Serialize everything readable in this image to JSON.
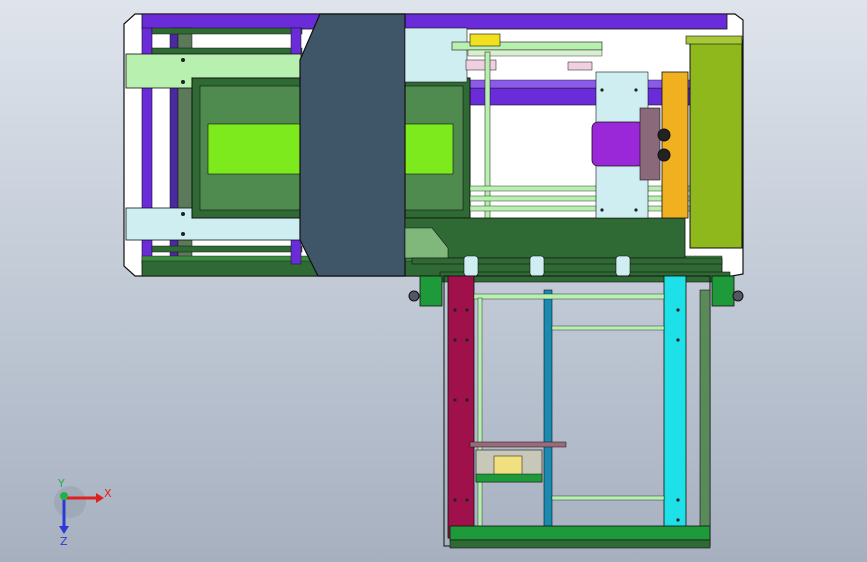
{
  "viewport": {
    "background_top": "#dfe4ec",
    "background_bottom": "#a6b0bf"
  },
  "triad": {
    "x_label": "X",
    "y_label": "Y",
    "z_label": "Z",
    "x_color": "#e02020",
    "y_color": "#22b04a",
    "z_color": "#2a3ad8"
  },
  "colors": {
    "purple_frame": "#6a2bd8",
    "dark_green": "#2f6a35",
    "green": "#1f9a3a",
    "light_green": "#b8f0b0",
    "lime": "#7dea1e",
    "olive": "#8fb81c",
    "orange": "#f0b020",
    "magenta": "#a0104a",
    "cyan": "#1ee0e8",
    "teal": "#1a8ab0",
    "slate": "#3f5668",
    "violet": "#9a28d8",
    "light_cyan": "#cfeef2",
    "grey_blue": "#7888a8"
  }
}
